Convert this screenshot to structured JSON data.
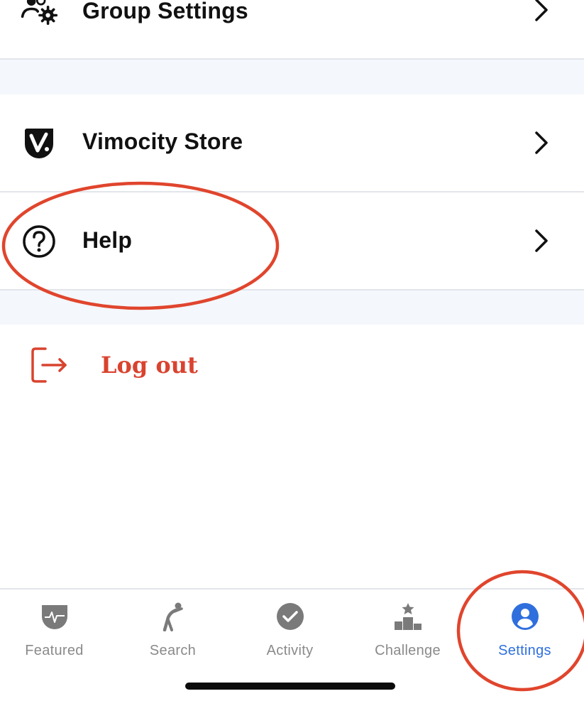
{
  "menu": {
    "group_settings": {
      "label": "Group Settings",
      "icon": "group-gear-icon"
    },
    "vimocity_store": {
      "label": "Vimocity Store",
      "icon": "vimocity-logo-icon"
    },
    "help": {
      "label": "Help",
      "icon": "question-circle-icon"
    },
    "logout": {
      "label": "Log out",
      "icon": "logout-icon"
    }
  },
  "tabbar": {
    "tabs": [
      {
        "label": "Featured",
        "icon": "heartbeat-icon"
      },
      {
        "label": "Search",
        "icon": "stretch-figure-icon"
      },
      {
        "label": "Activity",
        "icon": "check-circle-icon"
      },
      {
        "label": "Challenge",
        "icon": "podium-icon"
      },
      {
        "label": "Settings",
        "icon": "user-circle-icon"
      }
    ],
    "active_index": 4
  },
  "colors": {
    "accent_red": "#d9432f",
    "active_blue": "#2f6fdd",
    "inactive_gray": "#8a8a8a",
    "band_bg": "#f4f7fb",
    "annotation_red": "#e0452d"
  }
}
